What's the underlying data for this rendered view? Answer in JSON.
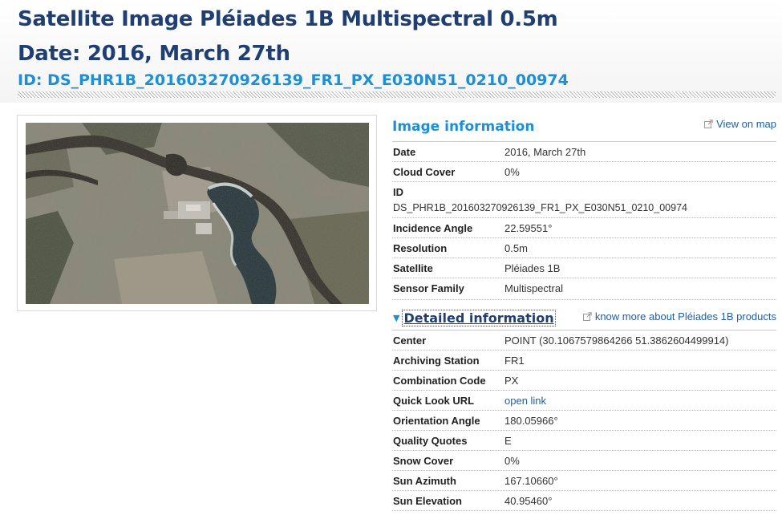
{
  "header": {
    "title_line1": "Satellite Image Pléiades 1B Multispectral 0.5m",
    "title_line2": "Date: 2016, March 27th",
    "id_line": "ID: DS_PHR1B_201603270926139_FR1_PX_E030N51_0210_00974"
  },
  "image_info": {
    "title": "Image information",
    "view_on_map": "View on map",
    "rows": {
      "date": {
        "label": "Date",
        "value": "2016, March 27th"
      },
      "cloud": {
        "label": "Cloud Cover",
        "value": "0%"
      },
      "id": {
        "label": "ID",
        "value": "DS_PHR1B_201603270926139_FR1_PX_E030N51_0210_00974"
      },
      "incidence": {
        "label": "Incidence Angle",
        "value": "22.59551°"
      },
      "resolution": {
        "label": "Resolution",
        "value": "0.5m"
      },
      "satellite": {
        "label": "Satellite",
        "value": "Pléiades 1B"
      },
      "sensor": {
        "label": "Sensor Family",
        "value": "Multispectral"
      }
    }
  },
  "detailed": {
    "title": "Detailed information",
    "know_more": "know more about Pléiades 1B products",
    "rows": {
      "center": {
        "label": "Center",
        "value": "POINT (30.1067579864266 51.3862604499914)"
      },
      "station": {
        "label": "Archiving Station",
        "value": "FR1"
      },
      "combination": {
        "label": "Combination Code",
        "value": "PX"
      },
      "quicklook": {
        "label": "Quick Look URL",
        "value": "open link"
      },
      "orientation": {
        "label": "Orientation Angle",
        "value": "180.05966°"
      },
      "quality": {
        "label": "Quality Quotes",
        "value": "E"
      },
      "snow": {
        "label": "Snow Cover",
        "value": "0%"
      },
      "azimuth": {
        "label": "Sun Azimuth",
        "value": "167.10660°"
      },
      "elevation": {
        "label": "Sun Elevation",
        "value": "40.95460°"
      }
    }
  },
  "colors": {
    "title": "#1f3f73",
    "accent": "#1d8fd4",
    "link": "#1f5f9f"
  },
  "icons": {
    "external_link": "external-link-icon",
    "expand": "triangle-down-icon"
  }
}
